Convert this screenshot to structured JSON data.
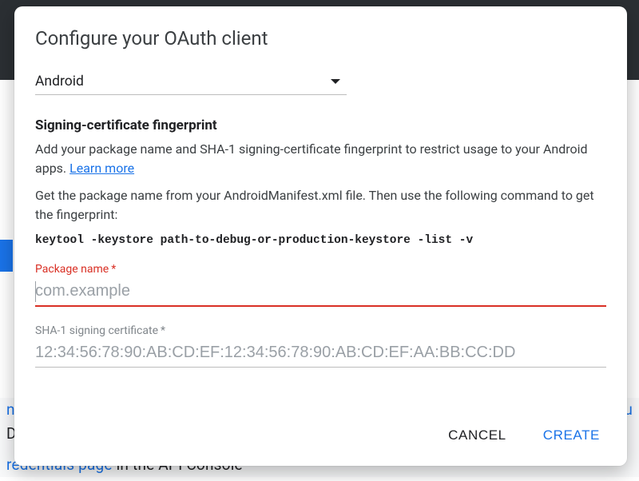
{
  "dialog": {
    "title": "Configure your OAuth client",
    "app_type_select": {
      "value": "Android"
    },
    "section_heading": "Signing-certificate fingerprint",
    "desc1_pre": "Add your package name and SHA-1 signing-certificate fingerprint to restrict usage to your Android apps. ",
    "desc1_link": "Learn more",
    "desc2": "Get the package name from your AndroidManifest.xml file. Then use the following command to get the fingerprint:",
    "command": "keytool -keystore path-to-debug-or-production-keystore -list -v",
    "package_field": {
      "label": "Package name",
      "required_mark": "*",
      "placeholder": "com.example",
      "value": ""
    },
    "sha1_field": {
      "label": "SHA-1 signing certificate",
      "required_mark": "*",
      "placeholder": "12:34:56:78:90:AB:CD:EF:12:34:56:78:90:AB:CD:EF:AA:BB:CC:DD",
      "value": ""
    },
    "actions": {
      "cancel": "CANCEL",
      "create": "CREATE"
    }
  },
  "background": {
    "link_fragment_left": "n",
    "link_fragment_right": "u",
    "line1_black": "D",
    "line2_link": "redentials page",
    "line2_rest": " in the API Console"
  }
}
